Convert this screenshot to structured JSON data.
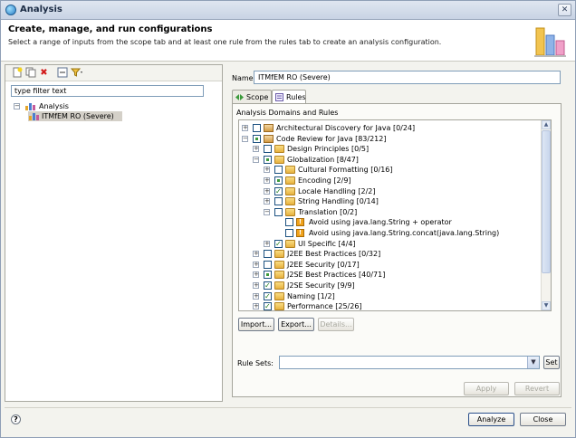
{
  "window": {
    "title": "Analysis",
    "close_glyph": "✕"
  },
  "header": {
    "title": "Create, manage, and run configurations",
    "description": "Select a range of inputs from the scope tab and at least one rule from the rules tab to create an analysis configuration."
  },
  "left": {
    "filter_placeholder": "type filter text",
    "tree": [
      {
        "label": "Analysis",
        "icon": "analysis-icon"
      },
      {
        "label": "ITMfEM RO (Severe)",
        "icon": "configuration-icon"
      }
    ]
  },
  "right": {
    "name_label": "Name:",
    "name_value": "ITMfEM RO (Severe)",
    "tabs": [
      {
        "label": "Scope",
        "icon": "scope-icon"
      },
      {
        "label": "Rules",
        "icon": "rules-icon"
      }
    ],
    "group_label": "Analysis Domains and Rules",
    "rules": [
      {
        "label": "Architectural Discovery for Java [0/24]",
        "state": "none",
        "expander": "+",
        "icon": "package-icon"
      },
      {
        "label": "Code Review for Java [83/212]",
        "state": "partial",
        "expander": "-",
        "icon": "package-icon"
      },
      {
        "label": "Design Principles [0/5]",
        "state": "none",
        "expander": "+",
        "icon": "folder-icon"
      },
      {
        "label": "Globalization [8/47]",
        "state": "partial",
        "expander": "-",
        "icon": "folder-icon"
      },
      {
        "label": "Cultural Formatting [0/16]",
        "state": "none",
        "expander": "+",
        "icon": "folder-icon"
      },
      {
        "label": "Encoding [2/9]",
        "state": "partial",
        "expander": "+",
        "icon": "folder-icon"
      },
      {
        "label": "Locale Handling [2/2]",
        "state": "checked",
        "expander": "+",
        "icon": "folder-icon"
      },
      {
        "label": "String Handling [0/14]",
        "state": "none",
        "expander": "+",
        "icon": "folder-icon"
      },
      {
        "label": "Translation [0/2]",
        "state": "none",
        "expander": "-",
        "icon": "folder-icon"
      },
      {
        "label": "Avoid using java.lang.String + operator",
        "state": "none",
        "expander": "",
        "icon": "warning-icon"
      },
      {
        "label": "Avoid using java.lang.String.concat(java.lang.String)",
        "state": "none",
        "expander": "",
        "icon": "warning-icon"
      },
      {
        "label": "UI Specific [4/4]",
        "state": "checked",
        "expander": "+",
        "icon": "folder-icon"
      },
      {
        "label": "J2EE Best Practices [0/32]",
        "state": "none",
        "expander": "+",
        "icon": "folder-icon"
      },
      {
        "label": "J2EE Security [0/17]",
        "state": "none",
        "expander": "+",
        "icon": "folder-icon"
      },
      {
        "label": "J2SE Best Practices [40/71]",
        "state": "partial",
        "expander": "+",
        "icon": "folder-icon"
      },
      {
        "label": "J2SE Security [9/9]",
        "state": "checked",
        "expander": "+",
        "icon": "folder-icon"
      },
      {
        "label": "Naming [1/2]",
        "state": "checked",
        "expander": "+",
        "icon": "folder-icon"
      },
      {
        "label": "Performance [25/26]",
        "state": "checked",
        "expander": "+",
        "icon": "folder-icon"
      }
    ],
    "buttons": {
      "import": "Import...",
      "export": "Export...",
      "details": "Details..."
    },
    "rulesets_label": "Rule Sets:",
    "rulesets_value": "",
    "set_button": "Set",
    "apply": "Apply",
    "revert": "Revert"
  },
  "footer": {
    "help": "?",
    "analyze": "Analyze",
    "close": "Close"
  }
}
